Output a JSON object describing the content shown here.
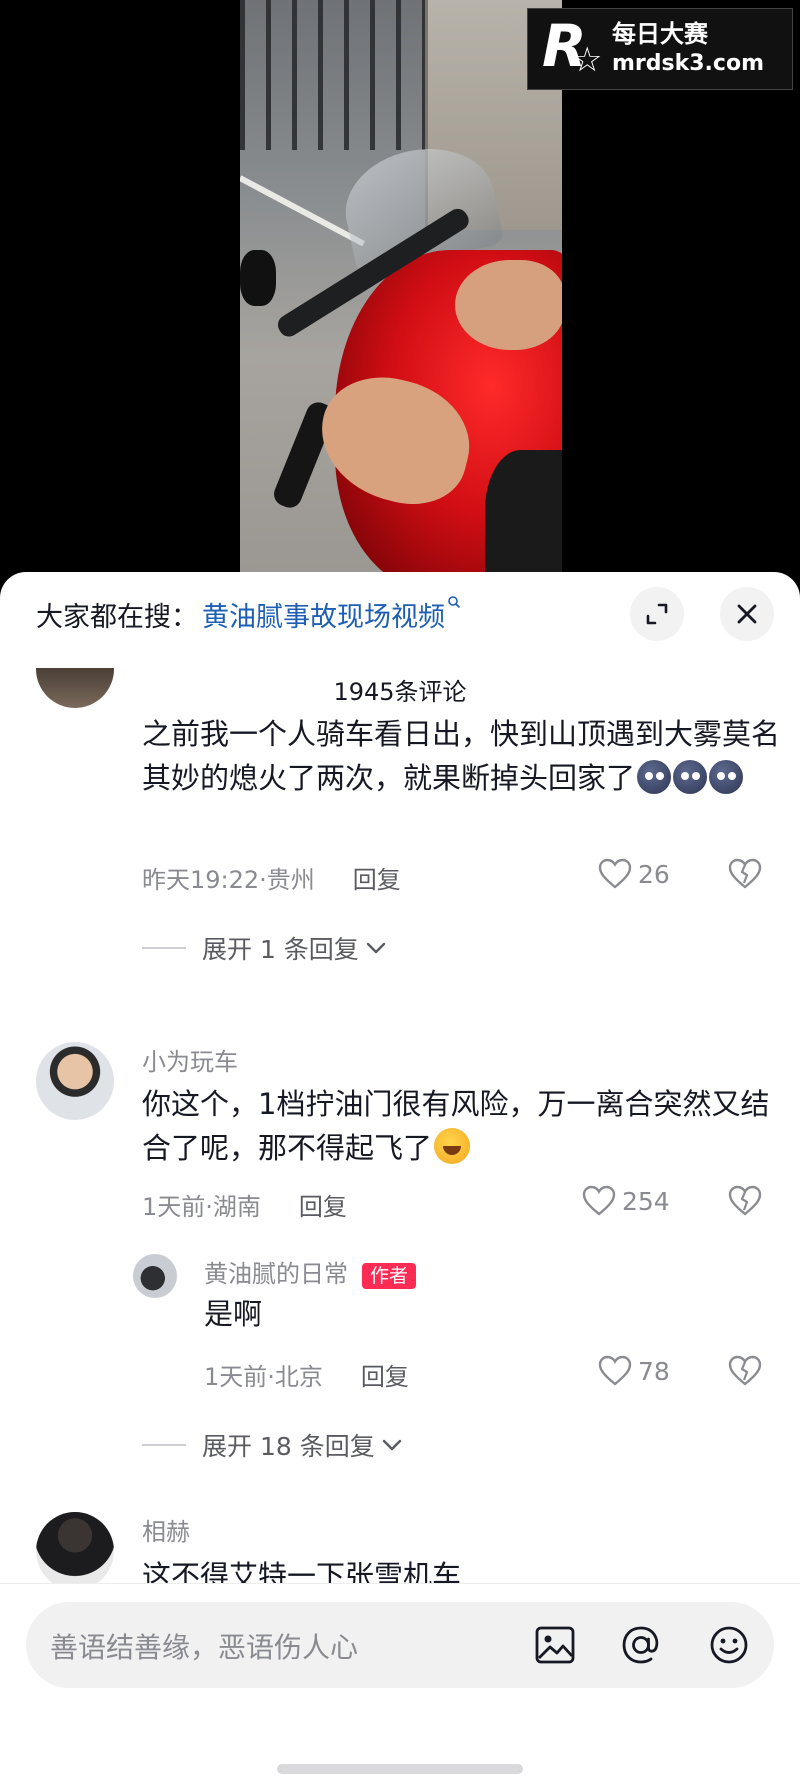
{
  "watermark": {
    "logo_letter": "R",
    "name": "每日大赛",
    "url": "mrdsk3.com"
  },
  "search": {
    "prefix": "大家都在搜：",
    "query": "黄油腻事故现场视频"
  },
  "comments_title": "1945条评论",
  "comments": [
    {
      "text": "之前我一个人骑车看日出，快到山顶遇到大雾莫名其妙的熄火了两次，就果断掉头回家了",
      "emoji": "blob-emoji x3",
      "time_location": "昨天19:22·贵州",
      "reply_label": "回复",
      "likes": "26",
      "expand_label": "展开 1 条回复"
    },
    {
      "username": "小为玩车",
      "text": "你这个，1档拧油门很有风险，万一离合突然又结合了呢，那不得起飞了",
      "emoji": "laugh-cry-emoji",
      "time_location": "1天前·湖南",
      "reply_label": "回复",
      "likes": "254",
      "reply": {
        "username": "黄油腻的日常",
        "badge": "作者",
        "text": "是啊",
        "time_location": "1天前·北京",
        "reply_label": "回复",
        "likes": "78"
      },
      "expand_label": "展开 18 条回复"
    },
    {
      "username": "相赫",
      "text": "这不得艾特一下张雪机车"
    }
  ],
  "input": {
    "placeholder": "善语结善缘，恶语伤人心"
  },
  "colors": {
    "link": "#1e5fb4",
    "badge": "#fe2c55",
    "muted": "#8a8b91",
    "text": "#161823"
  }
}
